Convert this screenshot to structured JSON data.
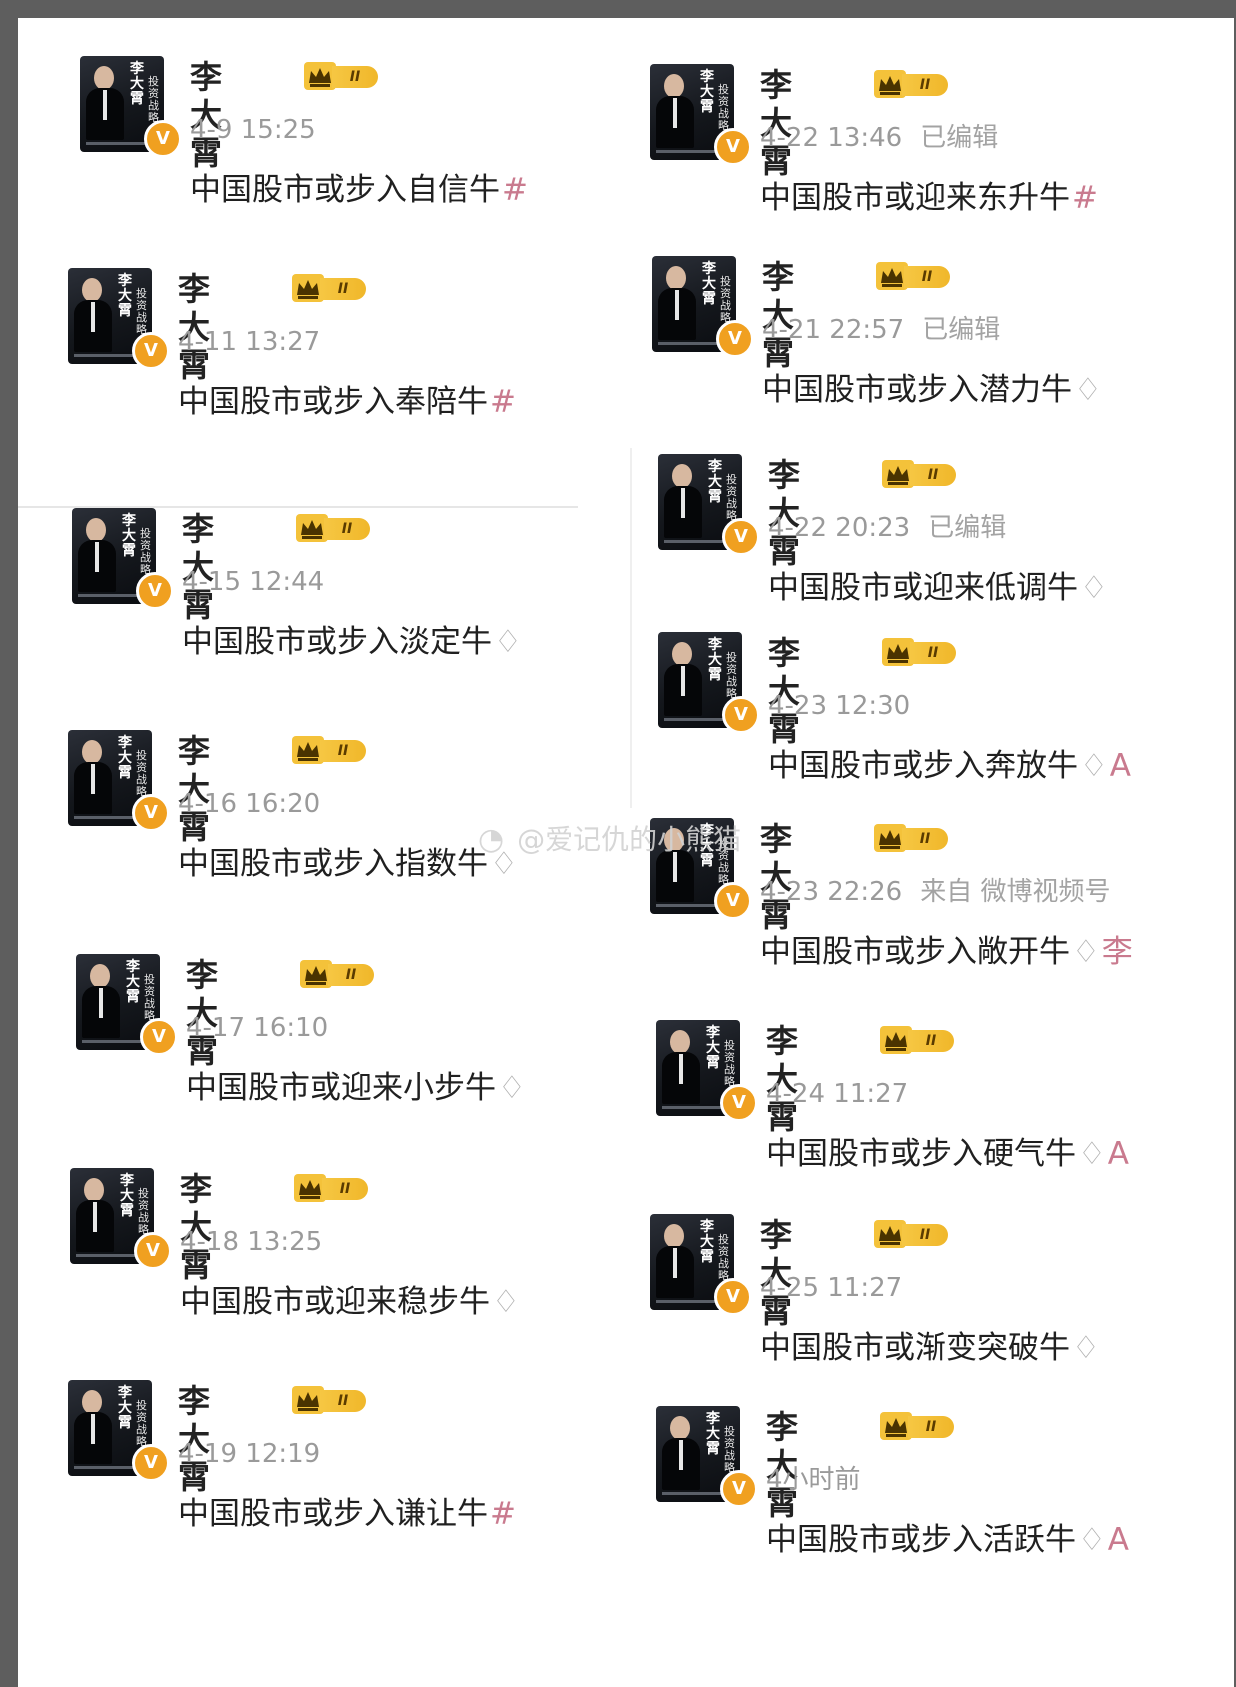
{
  "watermark": {
    "text": "@爱记仇的小熊猫",
    "icon": "weibo-logo-icon"
  },
  "avatar": {
    "book_title": "李大霄",
    "book_subtitle": "投资战略"
  },
  "badge": {
    "verified_mark": "V",
    "level": "II"
  },
  "left_posts": [
    {
      "name": "李大霄",
      "time": "4-9 15:25",
      "extra": "",
      "text": "中国股市或步入自信牛",
      "suffix": "#"
    },
    {
      "name": "李大霄",
      "time": "4-11 13:27",
      "extra": "",
      "text": "中国股市或步入奉陪牛",
      "suffix": "#"
    },
    {
      "name": "李大霄",
      "time": "4-15 12:44",
      "extra": "",
      "text": "中国股市或步入淡定牛",
      "suffix": ""
    },
    {
      "name": "李大霄",
      "time": "4-16 16:20",
      "extra": "",
      "text": "中国股市或步入指数牛",
      "suffix": ""
    },
    {
      "name": "李大霄",
      "time": "4-17 16:10",
      "extra": "",
      "text": "中国股市或迎来小步牛",
      "suffix": ""
    },
    {
      "name": "李大霄",
      "time": "4-18 13:25",
      "extra": "",
      "text": "中国股市或迎来稳步牛",
      "suffix": ""
    },
    {
      "name": "李大霄",
      "time": "4-19 12:19",
      "extra": "",
      "text": "中国股市或步入谦让牛",
      "suffix": "#"
    }
  ],
  "right_posts": [
    {
      "name": "李大霄",
      "time": "4-22 13:46",
      "extra": "已编辑",
      "text": "中国股市或迎来东升牛",
      "suffix": "#"
    },
    {
      "name": "李大霄",
      "time": "4-21 22:57",
      "extra": "已编辑",
      "text": "中国股市或步入潜力牛",
      "suffix": ""
    },
    {
      "name": "李大霄",
      "time": "4-22 20:23",
      "extra": "已编辑",
      "text": "中国股市或迎来低调牛",
      "suffix": ""
    },
    {
      "name": "李大霄",
      "time": "4-23 12:30",
      "extra": "",
      "text": "中国股市或步入奔放牛",
      "suffix": "A"
    },
    {
      "name": "李大霄",
      "time": "4-23 22:26",
      "extra": "来自 微博视频号",
      "text": "中国股市或步入敞开牛",
      "suffix": "李"
    },
    {
      "name": "李大霄",
      "time": "4-24 11:27",
      "extra": "",
      "text": "中国股市或步入硬气牛",
      "suffix": "A"
    },
    {
      "name": "李大霄",
      "time": "4-25 11:27",
      "extra": "",
      "text": "中国股市或渐变突破牛",
      "suffix": ""
    },
    {
      "name": "李大霄",
      "time": "4小时前",
      "extra": "",
      "text": "中国股市或步入活跃牛",
      "suffix": "A"
    }
  ],
  "colors": {
    "verified": "#f0a020",
    "level_pill": "#f6c743",
    "name": "#222222",
    "meta": "#9a9a9a"
  }
}
